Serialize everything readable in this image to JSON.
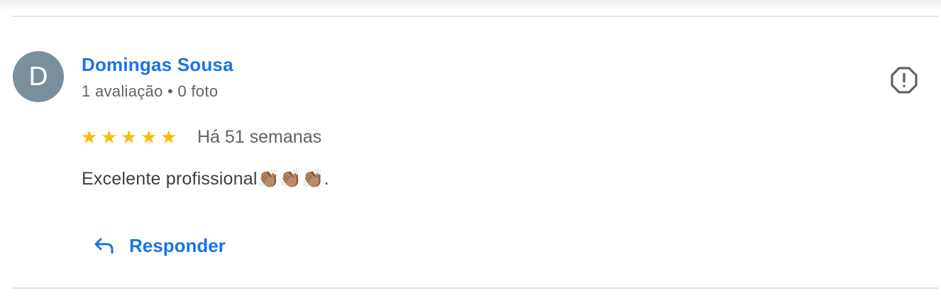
{
  "reviewer": {
    "initial": "D",
    "name": "Domingas Sousa",
    "meta": "1 avaliação • 0 foto",
    "avatar_color": "#78909c"
  },
  "review": {
    "rating": 5,
    "max_rating": 5,
    "stars": [
      "★",
      "★",
      "★",
      "★",
      "★"
    ],
    "date": "Há 51 semanas",
    "text": "Excelente profissional👏🏽👏🏽👏🏽."
  },
  "actions": {
    "flag_icon": "report-flag-icon",
    "reply_icon": "reply-arrow-icon",
    "reply_label": "Responder"
  },
  "colors": {
    "accent": "#1a73e8",
    "star": "#fbbc04",
    "secondary_text": "#5f6368"
  }
}
